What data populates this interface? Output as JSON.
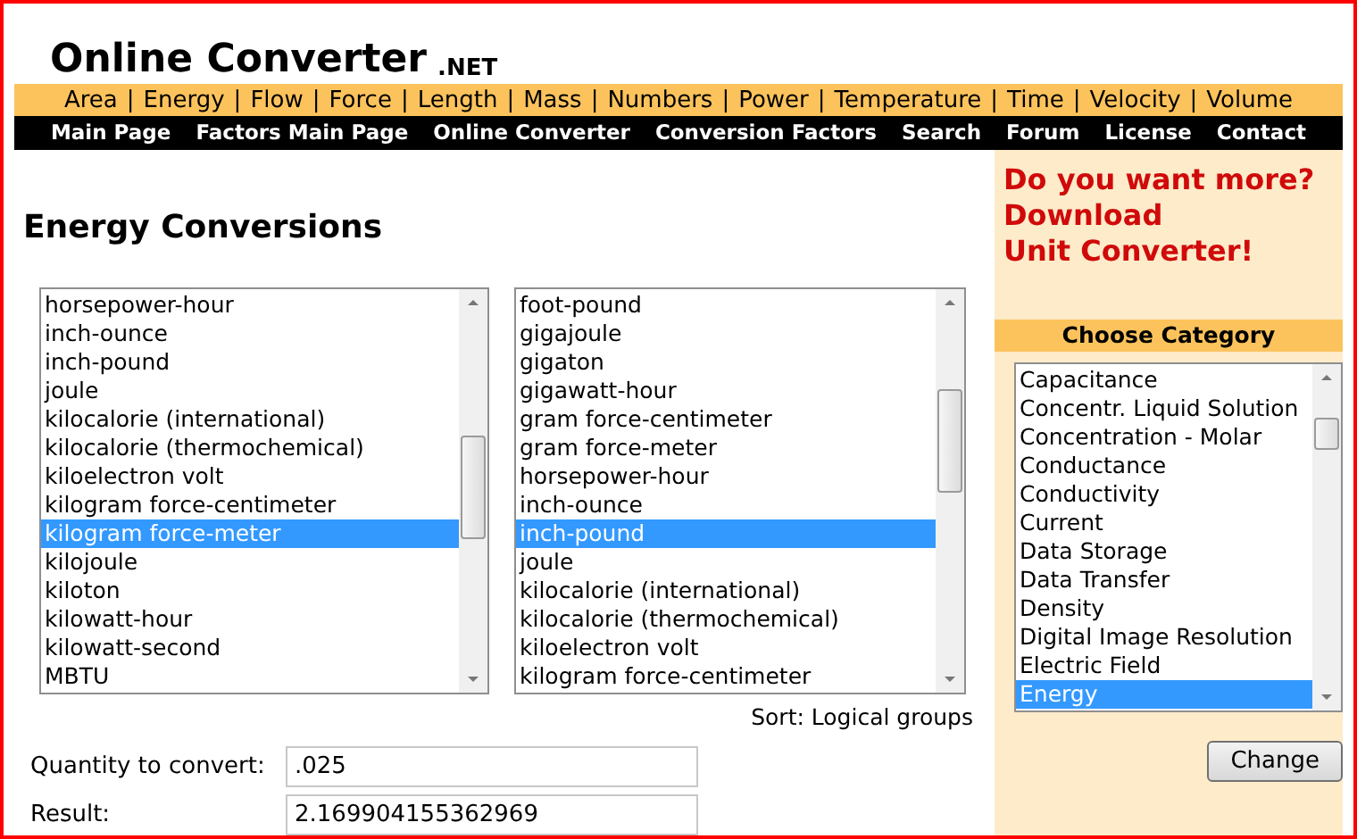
{
  "site": {
    "title": "Online Converter",
    "suffix": ".NET"
  },
  "category_nav_separator": "|",
  "category_nav": [
    "Area",
    "Energy",
    "Flow",
    "Force",
    "Length",
    "Mass",
    "Numbers",
    "Power",
    "Temperature",
    "Time",
    "Velocity",
    "Volume"
  ],
  "main_nav": [
    "Main Page",
    "Factors Main Page",
    "Online Converter",
    "Conversion Factors",
    "Search",
    "Forum",
    "License",
    "Contact"
  ],
  "heading": "Energy Conversions",
  "from_list": [
    {
      "label": "horsepower-hour",
      "selected": false
    },
    {
      "label": "inch-ounce",
      "selected": false
    },
    {
      "label": "inch-pound",
      "selected": false
    },
    {
      "label": "joule",
      "selected": false
    },
    {
      "label": "kilocalorie (international)",
      "selected": false
    },
    {
      "label": "kilocalorie (thermochemical)",
      "selected": false
    },
    {
      "label": "kiloelectron volt",
      "selected": false
    },
    {
      "label": "kilogram force-centimeter",
      "selected": false
    },
    {
      "label": "kilogram force-meter",
      "selected": true
    },
    {
      "label": "kilojoule",
      "selected": false
    },
    {
      "label": "kiloton",
      "selected": false
    },
    {
      "label": "kilowatt-hour",
      "selected": false
    },
    {
      "label": "kilowatt-second",
      "selected": false
    },
    {
      "label": "MBTU",
      "selected": false
    }
  ],
  "to_list": [
    {
      "label": "foot-pound",
      "selected": false
    },
    {
      "label": "gigajoule",
      "selected": false
    },
    {
      "label": "gigaton",
      "selected": false
    },
    {
      "label": "gigawatt-hour",
      "selected": false
    },
    {
      "label": "gram force-centimeter",
      "selected": false
    },
    {
      "label": "gram force-meter",
      "selected": false
    },
    {
      "label": "horsepower-hour",
      "selected": false
    },
    {
      "label": "inch-ounce",
      "selected": false
    },
    {
      "label": "inch-pound",
      "selected": true
    },
    {
      "label": "joule",
      "selected": false
    },
    {
      "label": "kilocalorie (international)",
      "selected": false
    },
    {
      "label": "kilocalorie (thermochemical)",
      "selected": false
    },
    {
      "label": "kiloelectron volt",
      "selected": false
    },
    {
      "label": "kilogram force-centimeter",
      "selected": false
    }
  ],
  "sort_label": "Sort: Logical groups",
  "quantity": {
    "label": "Quantity to convert:",
    "value": ".025"
  },
  "result": {
    "label": "Result:",
    "value": "2.169904155362969"
  },
  "promo": [
    "Do you want more?",
    "Download",
    "Unit Converter!"
  ],
  "category_panel": {
    "title": "Choose Category",
    "items": [
      {
        "label": "Capacitance",
        "selected": false
      },
      {
        "label": "Concentr. Liquid Solution",
        "selected": false
      },
      {
        "label": "Concentration - Molar",
        "selected": false
      },
      {
        "label": "Conductance",
        "selected": false
      },
      {
        "label": "Conductivity",
        "selected": false
      },
      {
        "label": "Current",
        "selected": false
      },
      {
        "label": "Data Storage",
        "selected": false
      },
      {
        "label": "Data Transfer",
        "selected": false
      },
      {
        "label": "Density",
        "selected": false
      },
      {
        "label": "Digital Image Resolution",
        "selected": false
      },
      {
        "label": "Electric Field",
        "selected": false
      },
      {
        "label": "Energy",
        "selected": true
      }
    ],
    "button": "Change"
  }
}
